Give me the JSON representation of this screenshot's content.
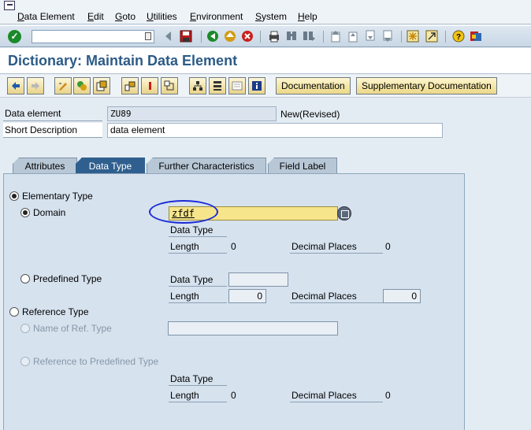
{
  "menu": {
    "items": [
      {
        "first": "D",
        "rest": "ata Element"
      },
      {
        "first": "E",
        "rest": "dit"
      },
      {
        "first": "G",
        "rest": "oto"
      },
      {
        "first": "U",
        "rest": "tilities"
      },
      {
        "first": "E",
        "rest": "nvironment"
      },
      {
        "first": "S",
        "rest": "ystem"
      },
      {
        "first": "H",
        "rest": "elp"
      }
    ]
  },
  "toolbar": {
    "command_value": "",
    "icons": [
      "back-icon",
      "save-icon",
      "green-back-icon",
      "exit-icon",
      "cancel-icon",
      "print-icon",
      "find-icon",
      "find-next-icon",
      "first-page-icon",
      "previous-page-icon",
      "next-page-icon",
      "last-page-icon",
      "create-session-icon",
      "create-shortcut-icon",
      "help-icon",
      "layout-icon"
    ]
  },
  "page_title": "Dictionary: Maintain Data Element",
  "app_toolbar": {
    "documentation_label": "Documentation",
    "supplementary_label": "Supplementary Documentation"
  },
  "header": {
    "data_element_label": "Data element",
    "data_element_value": "ZU89",
    "status": "New(Revised)",
    "short_desc_label": "Short Description",
    "short_desc_value": "data element"
  },
  "tabs": [
    {
      "label": "Attributes",
      "active": false
    },
    {
      "label": "Data Type",
      "active": true
    },
    {
      "label": "Further Characteristics",
      "active": false
    },
    {
      "label": "Field Label",
      "active": false
    }
  ],
  "data_type": {
    "elementary_label": "Elementary Type",
    "domain_label": "Domain",
    "domain_value": "zfdf",
    "domain_sub": {
      "data_type_label": "Data Type",
      "length_label": "Length",
      "length_value": "0",
      "decimal_label": "Decimal Places",
      "decimal_value": "0"
    },
    "predefined_label": "Predefined Type",
    "predefined_sub": {
      "data_type_label": "Data Type",
      "data_type_value": "",
      "length_label": "Length",
      "length_value": "0",
      "decimal_label": "Decimal Places",
      "decimal_value": "0"
    },
    "reference_label": "Reference Type",
    "ref_name_label": "Name of Ref. Type",
    "ref_name_value": "",
    "ref_predefined_label": "Reference to Predefined Type",
    "ref_sub": {
      "data_type_label": "Data Type",
      "length_label": "Length",
      "length_value": "0",
      "decimal_label": "Decimal Places",
      "decimal_value": "0"
    }
  }
}
